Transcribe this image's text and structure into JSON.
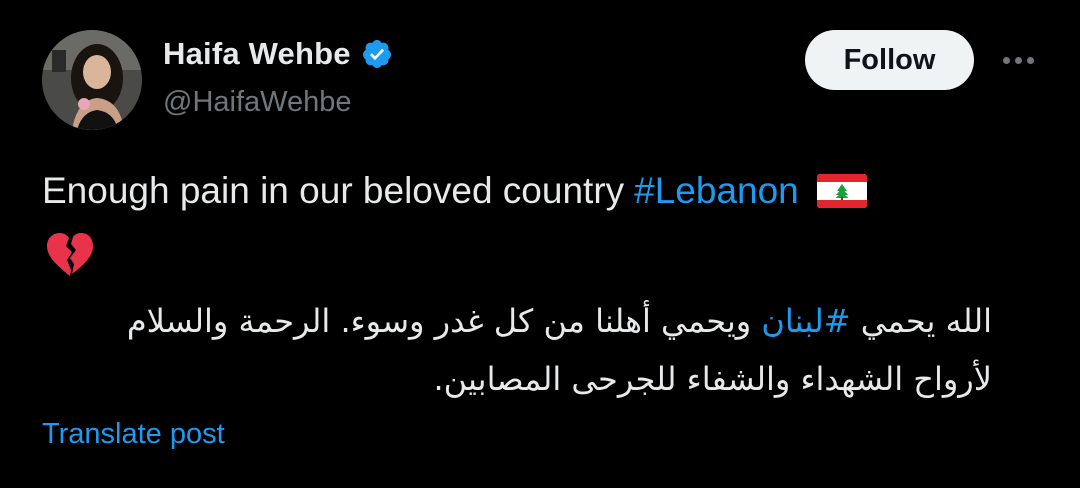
{
  "author": {
    "display_name": "Haifa Wehbe",
    "handle": "@HaifaWehbe",
    "verified": true
  },
  "actions": {
    "follow_label": "Follow",
    "more_icon": "more-horizontal-icon"
  },
  "tweet": {
    "line1_text": "Enough pain in our beloved country",
    "line1_hashtag": "#Lebanon",
    "flag_emoji": "lebanon-flag-icon",
    "heart_emoji": "broken-heart-icon",
    "arabic_part1": "الله يحمي ",
    "arabic_hashtag": "#لبنان",
    "arabic_part2": " ويحمي أهلنا من كل غدر وسوء. الرحمة والسلام لأرواح الشهداء والشفاء للجرحى المصابين."
  },
  "translate_label": "Translate post",
  "colors": {
    "background": "#000000",
    "text": "#e7e9ea",
    "muted": "#71767b",
    "link": "#1d9bf0",
    "follow_bg": "#eff3f4"
  }
}
